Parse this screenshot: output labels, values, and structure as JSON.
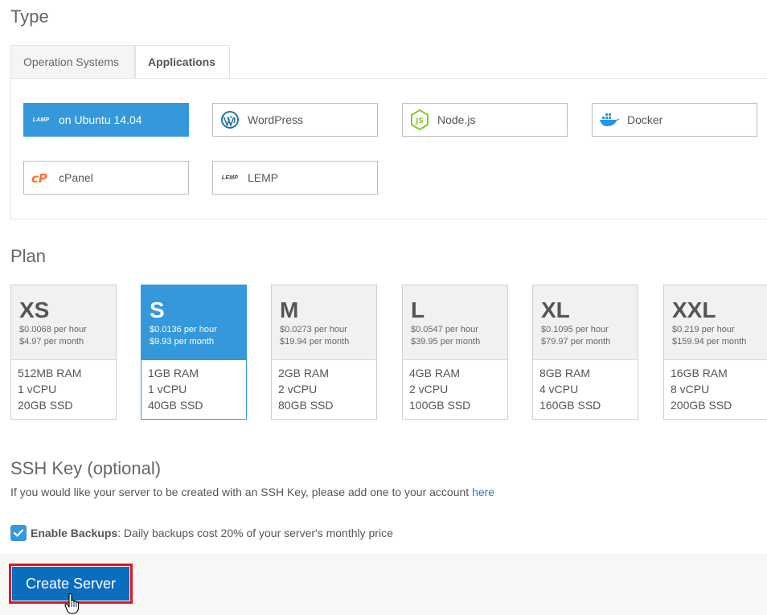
{
  "type_section": {
    "title": "Type",
    "tabs": [
      {
        "label": "Operation Systems",
        "active": false
      },
      {
        "label": "Applications",
        "active": true
      }
    ],
    "apps": [
      {
        "icon": "lamp-logo-icon",
        "logo_text": "LAMP",
        "label": "on Ubuntu 14.04",
        "selected": true
      },
      {
        "icon": "wordpress-icon",
        "label": "WordPress",
        "selected": false
      },
      {
        "icon": "nodejs-icon",
        "label": "Node.js",
        "selected": false
      },
      {
        "icon": "docker-icon",
        "label": "Docker",
        "selected": false
      },
      {
        "icon": "cpanel-icon",
        "label": "cPanel",
        "selected": false
      },
      {
        "icon": "lemp-logo-icon",
        "logo_text": "LEMP",
        "label": "LEMP",
        "selected": false
      }
    ]
  },
  "plan_section": {
    "title": "Plan",
    "plans": [
      {
        "size": "XS",
        "hourly": "$0.0068 per hour",
        "monthly": "$4.97 per month",
        "ram": "512MB RAM",
        "cpu": "1 vCPU",
        "disk": "20GB SSD",
        "selected": false
      },
      {
        "size": "S",
        "hourly": "$0.0136 per hour",
        "monthly": "$9.93 per month",
        "ram": "1GB RAM",
        "cpu": "1 vCPU",
        "disk": "40GB SSD",
        "selected": true
      },
      {
        "size": "M",
        "hourly": "$0.0273 per hour",
        "monthly": "$19.94 per month",
        "ram": "2GB RAM",
        "cpu": "2 vCPU",
        "disk": "80GB SSD",
        "selected": false
      },
      {
        "size": "L",
        "hourly": "$0.0547 per hour",
        "monthly": "$39.95 per month",
        "ram": "4GB RAM",
        "cpu": "2 vCPU",
        "disk": "100GB SSD",
        "selected": false
      },
      {
        "size": "XL",
        "hourly": "$0.1095 per hour",
        "monthly": "$79.97 per month",
        "ram": "8GB RAM",
        "cpu": "4 vCPU",
        "disk": "160GB SSD",
        "selected": false
      },
      {
        "size": "XXL",
        "hourly": "$0.219 per hour",
        "monthly": "$159.94 per month",
        "ram": "16GB RAM",
        "cpu": "8 vCPU",
        "disk": "200GB SSD",
        "selected": false
      }
    ]
  },
  "ssh_section": {
    "title": "SSH Key (optional)",
    "description": "If you would like your server to be created with an SSH Key, please add one to your account ",
    "link_text": "here"
  },
  "backups": {
    "checked": true,
    "label": "Enable Backups",
    "colon": ":",
    "description": " Daily backups cost 20% of your server's monthly price"
  },
  "actions": {
    "create_label": "Create Server"
  },
  "colors": {
    "accent": "#3498db",
    "primary_button": "#0b6dbf",
    "highlight_border": "#e3161e",
    "link": "#2a7ab8"
  }
}
